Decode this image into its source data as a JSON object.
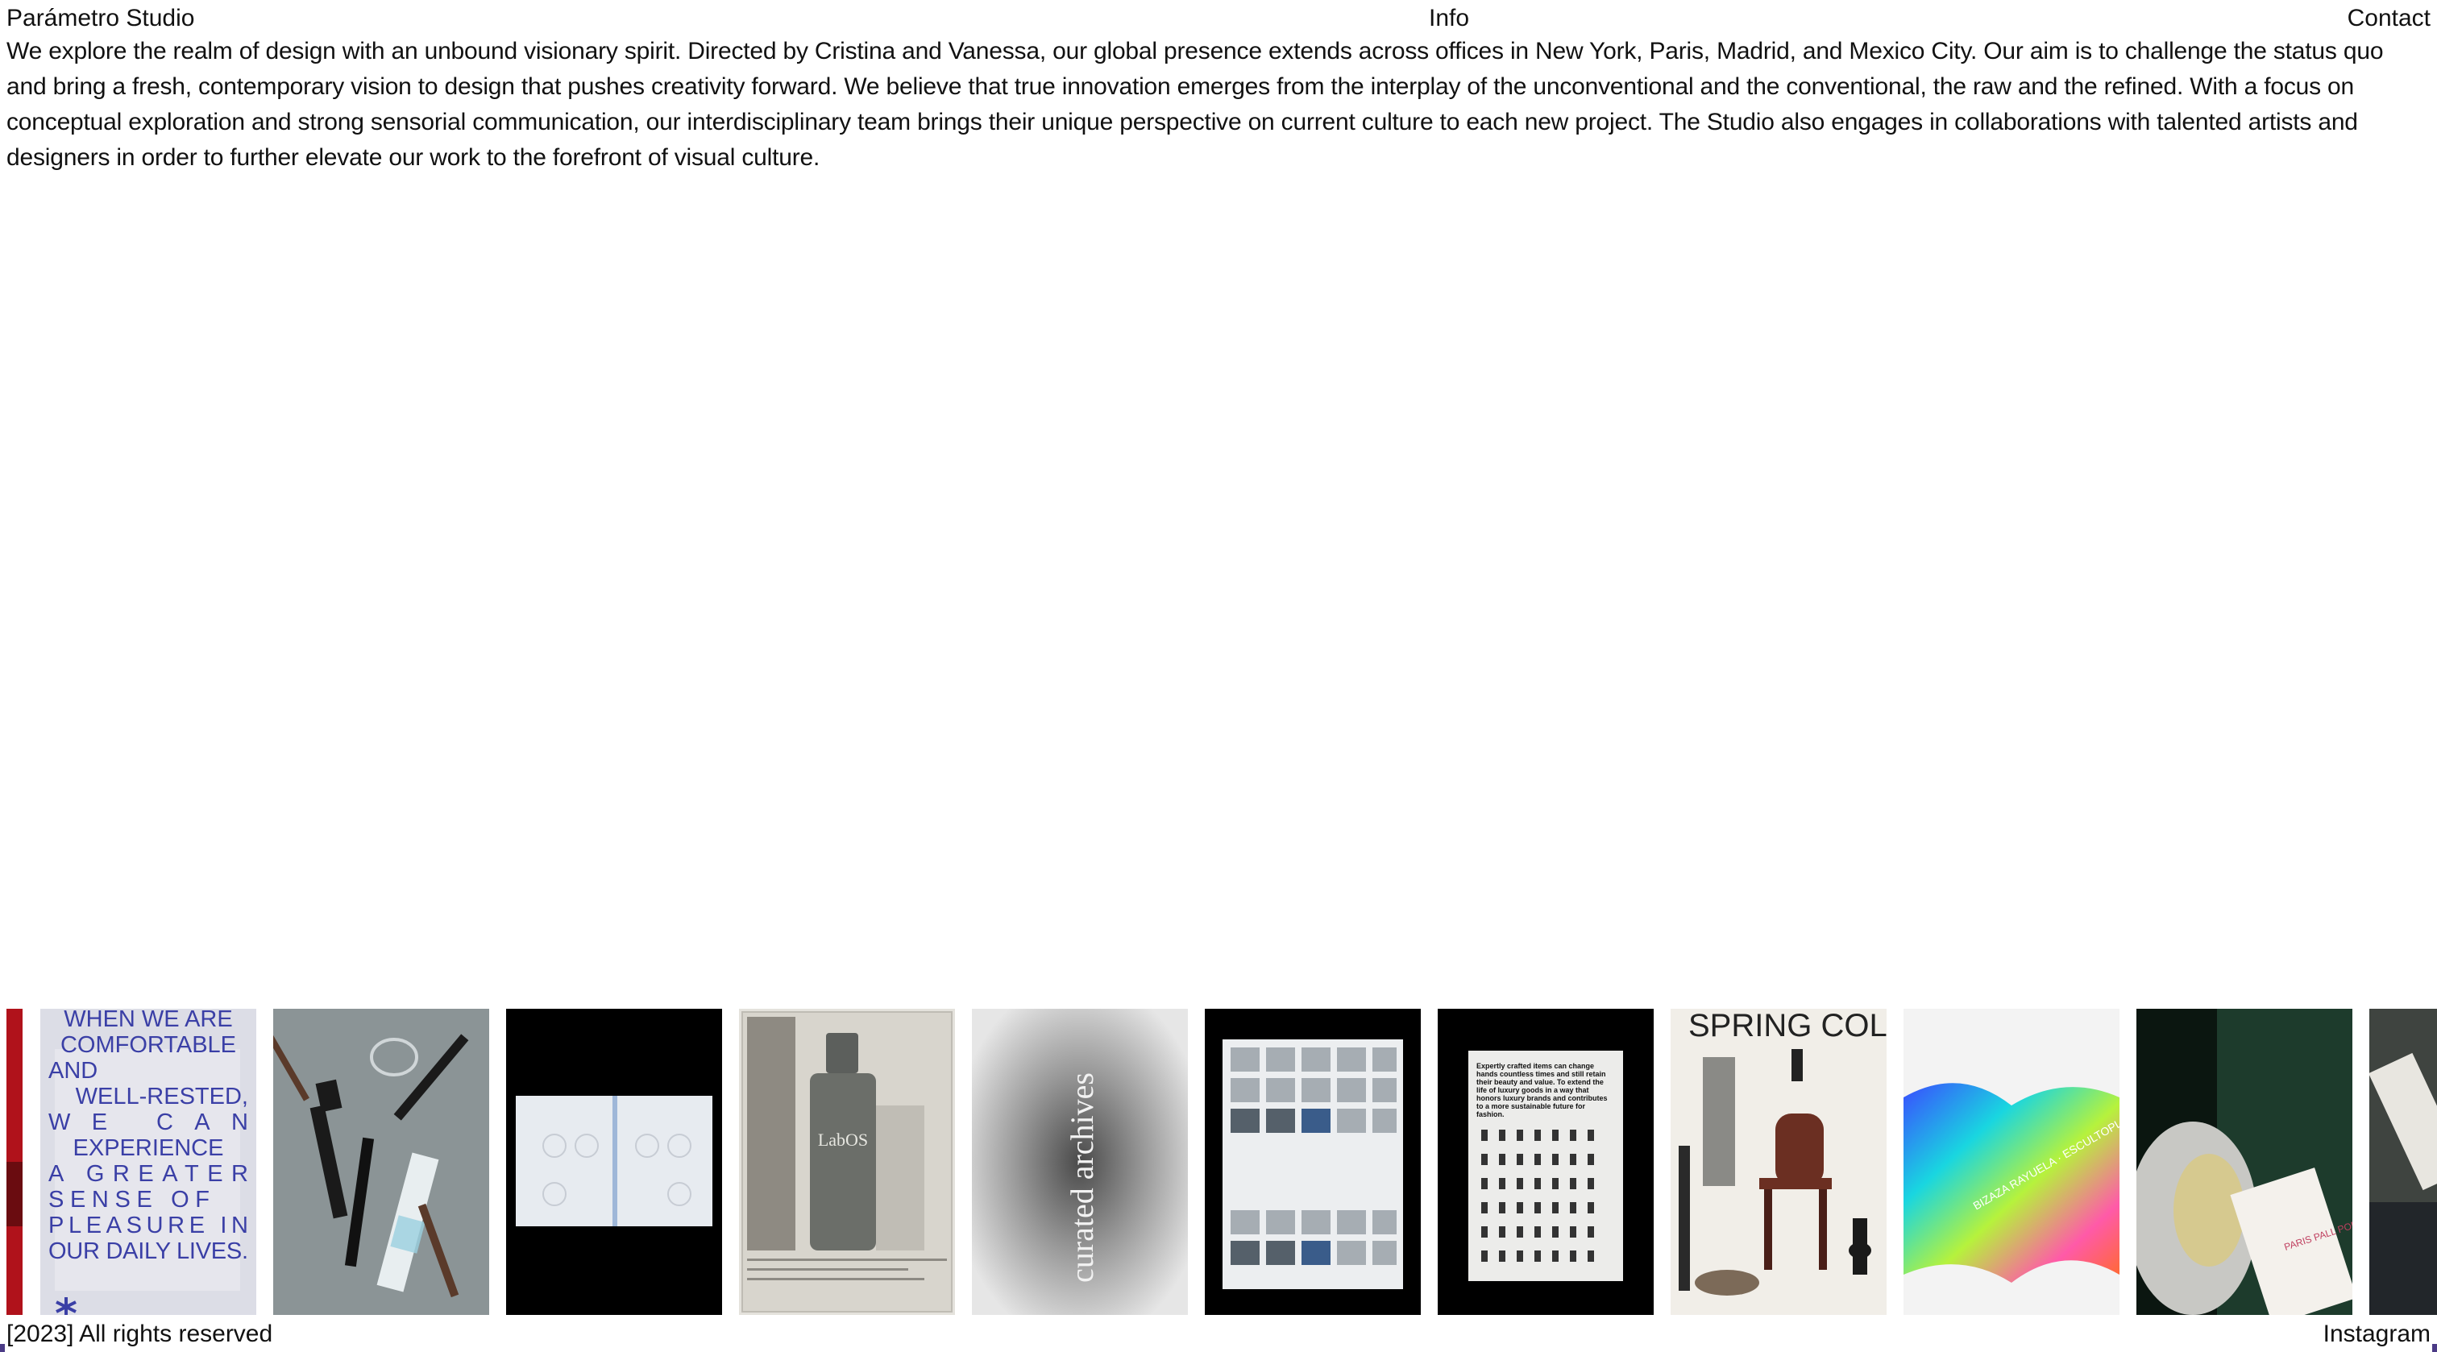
{
  "nav": {
    "brand": "Parámetro Studio",
    "info": "Info",
    "contact": "Contact"
  },
  "intro": {
    "text": "We explore the realm of design with an unbound visionary spirit. Directed by Cristina and Vanessa, our global presence extends across offices in New York, Paris, Madrid, and Mexico City. Our aim is to challenge the status quo and bring a fresh, contemporary vision to design that pushes creativity forward. We believe that true innovation emerges from the interplay of the unconventional and the conventional, the raw and the refined. With a focus on conceptual exploration and strong sensorial communication, our interdisciplinary team brings their unique perspective on current culture to each new project. The Studio also engages in collaborations with talented artists and designers in order to further elevate our work to the forefront of visual culture."
  },
  "gallery": {
    "poster_lines": [
      "WHEN WE ARE",
      "COMFORTABLE",
      "AND",
      "WELL-RESTED,",
      "WE CAN",
      "EXPERIENCE",
      "A GREATER",
      "SENSE OF",
      "PLEASURE IN",
      "OUR DAILY LIVES."
    ],
    "bottle_label": "LabOS",
    "archive_text": "curated archives",
    "crafted_text": "Expertly crafted items can change hands countless times and still retain their beauty and value. To extend the life of luxury goods in a way that honors luxury brands and contributes to a more sustainable future for fashion.",
    "spring_text": "SPRING COL",
    "cup_text": "BIZAZA RAYUELA · ESCULTOPLÁSTICO",
    "card_text": "PARIS PALL POP-UP LOUVELLE SPECIAL"
  },
  "footer": {
    "copyright": "[2023] All rights reserved",
    "instagram": "Instagram"
  },
  "colors": {
    "background": "#ffffff",
    "text": "#111111",
    "poster_text": "#3a3fa6",
    "edge_accent": "#4b3b86"
  }
}
